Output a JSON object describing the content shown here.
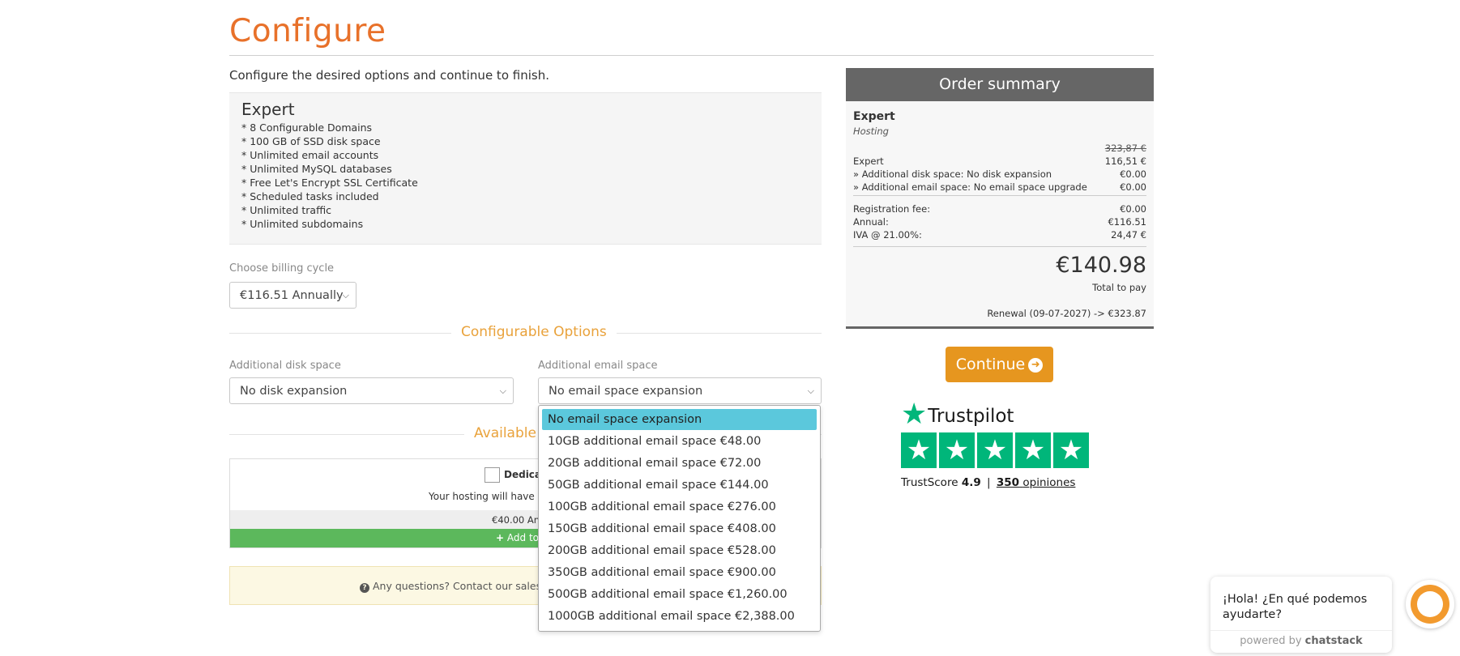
{
  "page": {
    "title": "Configure",
    "intro": "Configure the desired options and continue to finish."
  },
  "product": {
    "name": "Expert",
    "features": [
      "* 8 Configurable Domains",
      "* 100 GB of SSD disk space",
      "* Unlimited email accounts",
      "* Unlimited MySQL databases",
      "* Free Let's Encrypt SSL Certificate",
      "* Scheduled tasks included",
      "* Unlimited traffic",
      "* Unlimited subdomains"
    ]
  },
  "billing": {
    "label": "Choose billing cycle",
    "value": "€116.51 Annually"
  },
  "config_options": {
    "heading": "Configurable Options",
    "disk_label": "Additional disk space",
    "disk_value": "No disk expansion",
    "email_label": "Additional email space",
    "email_value": "No email space expansion"
  },
  "email_dropdown": {
    "selected_index": 0,
    "options": [
      "No email space expansion",
      "10GB additional email space €48.00",
      "20GB additional email space €72.00",
      "50GB additional email space €144.00",
      "100GB additional email space €276.00",
      "150GB additional email space €408.00",
      "200GB additional email space €528.00",
      "350GB additional email space €900.00",
      "500GB additional email space €1,260.00",
      "1000GB additional email space €2,388.00"
    ]
  },
  "addons": {
    "heading_visible": "Available o",
    "item_title_visible": "Dedicat",
    "item_desc_visible": "Your hosting will have a d",
    "item_price_visible": "€40.00 Ann",
    "add_button_visible": "Add to"
  },
  "help": {
    "text_visible": "Any questions? Contact our sales dep"
  },
  "summary": {
    "heading": "Order summary",
    "product": "Expert",
    "group": "Hosting",
    "old_price": "323,87 €",
    "lines": [
      {
        "label": "Expert",
        "value": "116,51 €"
      },
      {
        "label": "» Additional disk space: No disk expansion",
        "value": "€0.00"
      },
      {
        "label": "» Additional email space: No email space upgrade",
        "value": "€0.00"
      }
    ],
    "totals": [
      {
        "label": "Registration fee:",
        "value": "€0.00"
      },
      {
        "label": "Annual:",
        "value": "€116.51"
      },
      {
        "label": "IVA @ 21.00%:",
        "value": "24,47 €"
      }
    ],
    "total": "€140.98",
    "total_label": "Total to pay",
    "renewal": "Renewal (09-07-2027) -> €323.87"
  },
  "continue_label": "Continue",
  "trustpilot": {
    "brand": "Trustpilot",
    "score_label": "TrustScore",
    "score": "4.9",
    "separator": "|",
    "reviews_count": "350",
    "reviews_label": "opiniones",
    "stars_rating": 5,
    "color": "#00b67a"
  },
  "chat": {
    "message": "¡Hola! ¿En qué podemos ayudarte?",
    "powered_prefix": "powered by",
    "powered_brand": "chatstack"
  },
  "colors": {
    "accent_orange": "#e8712a",
    "section_orange": "#e9a23b",
    "button_orange": "#e6961f",
    "dropdown_highlight": "#5bc8dc",
    "add_button_green": "#5cb85c"
  }
}
